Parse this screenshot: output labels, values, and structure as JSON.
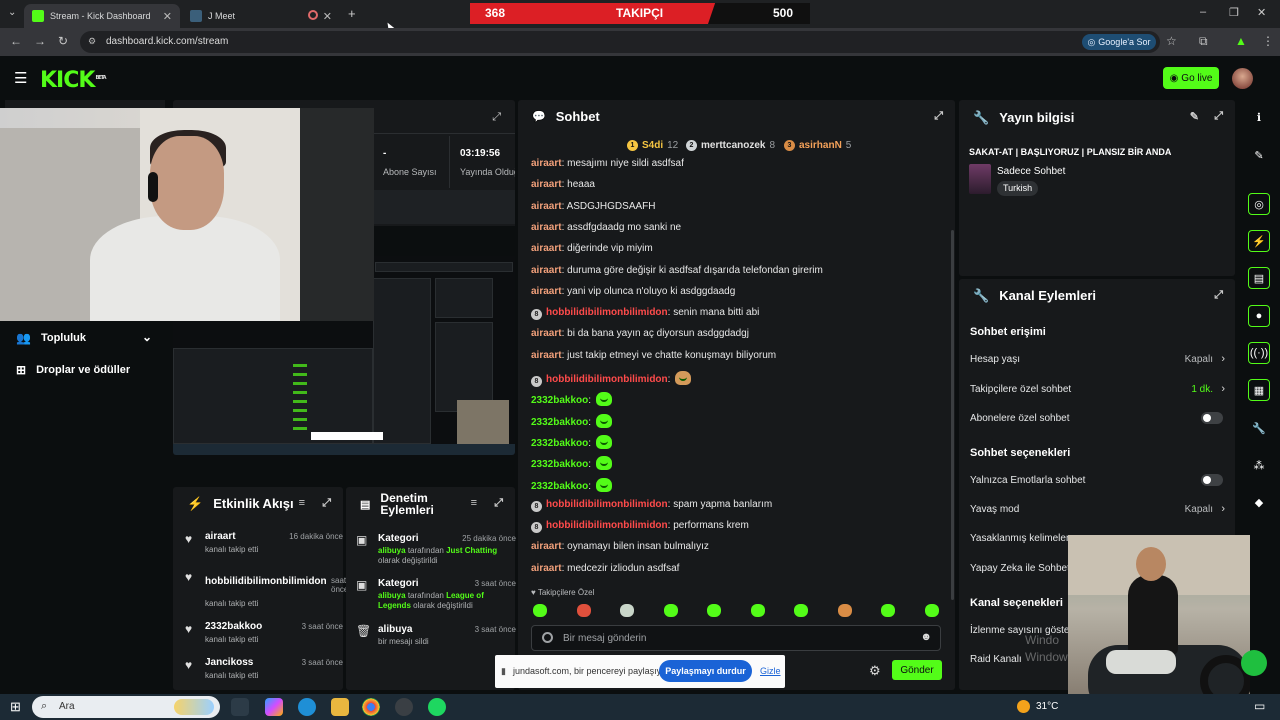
{
  "browser": {
    "tabs": [
      {
        "label": "Stream - Kick Dashboard",
        "close": "✕"
      },
      {
        "label": "J Meet",
        "close": "✕"
      }
    ],
    "new_tab": "+",
    "url": "dashboard.kick.com/stream",
    "google_pill": "Google'a Sor",
    "window_controls": {
      "minimize": "–",
      "restore": "❐",
      "close": "✕"
    }
  },
  "follower_bar": {
    "current": "368",
    "label": "TAKIPÇI",
    "goal": "500",
    "progress": 0.736
  },
  "kick": {
    "logo": "KICK",
    "logo_tag": "BETA",
    "go_live": "Go live"
  },
  "left_nav": {
    "items": [
      {
        "label": "Topluluk",
        "icon": "people-icon"
      },
      {
        "label": "Droplar ve ödüller",
        "icon": "gift-icon"
      }
    ]
  },
  "stream_stats": [
    {
      "value": "-",
      "label": "Abone Sayısı"
    },
    {
      "value": "03:19:56",
      "label": "Yayında Olduğu"
    }
  ],
  "events": {
    "title": "Etkinlik Akışı",
    "items": [
      {
        "name": "airaart",
        "time": "16 dakika önce",
        "desc": "kanalı takip etti"
      },
      {
        "name": "hobbilidibilimonbilimidon",
        "time": "saat önce",
        "desc": "kanalı takip etti"
      },
      {
        "name": "2332bakkoo",
        "time": "3 saat önce",
        "desc": "kanalı takip etti"
      },
      {
        "name": "Jancikoss",
        "time": "3 saat önce",
        "desc": "kanalı takip etti"
      }
    ]
  },
  "moderation": {
    "title": "Denetim Eylemleri",
    "items": [
      {
        "title": "Kategori",
        "time": "25 dakika önce",
        "user": "alibuya",
        "mid": "tarafından",
        "category": "Just Chatting",
        "end": "olarak değiştirildi"
      },
      {
        "title": "Kategori",
        "time": "3 saat önce",
        "user": "alibuya",
        "mid": "tarafından",
        "category": "League of Legends",
        "end": "olarak değiştirildi"
      },
      {
        "title": "alibuya",
        "time": "3 saat önce",
        "desc": "bir mesajı sildi"
      }
    ]
  },
  "chat": {
    "title": "Sohbet",
    "top_chatters": [
      {
        "rank": "1",
        "name": "S4di",
        "count": "12",
        "color": "#f5c542"
      },
      {
        "rank": "2",
        "name": "merttcanozek",
        "count": "8",
        "color": "#cfd3d6"
      },
      {
        "rank": "3",
        "name": "asirhanN",
        "count": "5",
        "color": "#d98c45"
      }
    ],
    "messages": [
      {
        "user": "airaart",
        "text": "mesajımı niye sildi asdfsaf",
        "color": "#f2a07b"
      },
      {
        "user": "airaart",
        "text": "heaaa",
        "color": "#f2a07b"
      },
      {
        "user": "airaart",
        "text": "ASDGJHGDSAAFH",
        "color": "#f2a07b"
      },
      {
        "user": "airaart",
        "text": "assdfgdaadg mo sanki ne",
        "color": "#f2a07b"
      },
      {
        "user": "airaart",
        "text": "diğerinde vip miyim",
        "color": "#f2a07b"
      },
      {
        "user": "airaart",
        "text": "duruma göre değişir ki asdfsaf dışarıda telefondan girerim",
        "color": "#f2a07b"
      },
      {
        "user": "airaart",
        "text": "yani vip olunca n'oluyo ki asdggdaadg",
        "color": "#f2a07b"
      },
      {
        "user": "hobbilidibilimonbilimidon",
        "text": "senin mana bitti abi",
        "color": "#ff4b4b",
        "badge": "8"
      },
      {
        "user": "airaart",
        "text": "bi da bana yayın aç diyorsun asdggdadgj",
        "color": "#f2a07b"
      },
      {
        "user": "airaart",
        "text": "just takip etmeyi ve chatte konuşmayı biliyorum",
        "color": "#f2a07b"
      },
      {
        "user": "hobbilidibilimonbilimidon",
        "text": "",
        "color": "#ff4b4b",
        "badge": "8",
        "emote": "sticker"
      },
      {
        "user": "2332bakkoo",
        "text": "",
        "color": "#53fc18",
        "emote": "kick"
      },
      {
        "user": "2332bakkoo",
        "text": "",
        "color": "#53fc18",
        "emote": "kick"
      },
      {
        "user": "2332bakkoo",
        "text": "",
        "color": "#53fc18",
        "emote": "kick"
      },
      {
        "user": "2332bakkoo",
        "text": "",
        "color": "#53fc18",
        "emote": "kick"
      },
      {
        "user": "2332bakkoo",
        "text": "",
        "color": "#53fc18",
        "emote": "kick"
      },
      {
        "user": "hobbilidibilimonbilimidon",
        "text": "spam yapma banlarım",
        "color": "#ff4b4b",
        "badge": "8"
      },
      {
        "user": "hobbilidibilimonbilimidon",
        "text": "performans krem",
        "color": "#ff4b4b",
        "badge": "8"
      },
      {
        "user": "airaart",
        "text": "oynamayı bilen insan bulmalıyız",
        "color": "#f2a07b"
      },
      {
        "user": "airaart",
        "text": "medcezir izliodun asdfsaf",
        "color": "#f2a07b"
      }
    ],
    "followers_only": "Takipçilere Özel",
    "placeholder": "Bir mesaj gönderin",
    "send": "Gönder"
  },
  "share_banner": {
    "text": "jundasoft.com, bir pencereyi paylaşıyor.",
    "stop": "Paylaşmayı durdur",
    "hide": "Gizle"
  },
  "stream_info": {
    "title": "Yayın bilgisi",
    "stream_title": "SAKAT-AT | BAŞLIYORUZ | PLANSIZ BİR ANDA",
    "category": "Sadece Sohbet",
    "language": "Turkish"
  },
  "channel_actions": {
    "title": "Kanal Eylemleri",
    "chat_access": "Sohbet erişimi",
    "rows_access": [
      {
        "label": "Hesap yaşı",
        "value": "Kapalı"
      },
      {
        "label": "Takipçilere özel sohbet",
        "value": "1 dk."
      },
      {
        "label": "Abonelere özel sohbet",
        "value": ""
      }
    ],
    "chat_options": "Sohbet seçenekleri",
    "rows_options": [
      {
        "label": "Yalnızca Emotlarla sohbet",
        "value": ""
      },
      {
        "label": "Yavaş mod",
        "value": "Kapalı"
      },
      {
        "label": "Yasaklanmış kelimeler",
        "value": ""
      },
      {
        "label": "Yapay Zeka ile Sohbet",
        "value": ""
      }
    ],
    "channel_options": "Kanal seçenekleri",
    "rows_channel": [
      {
        "label": "İzlenme sayısını göster"
      },
      {
        "label": "Raid Kanalı"
      }
    ]
  },
  "watermark": {
    "line1": "Windo",
    "line2": "Windows"
  },
  "taskbar": {
    "search": "Ara",
    "weather": "31°C"
  },
  "colors": {
    "accent": "#53fc18",
    "panel": "#17191b",
    "bg": "#0b0e0f",
    "follower_red": "#dc1f25"
  }
}
